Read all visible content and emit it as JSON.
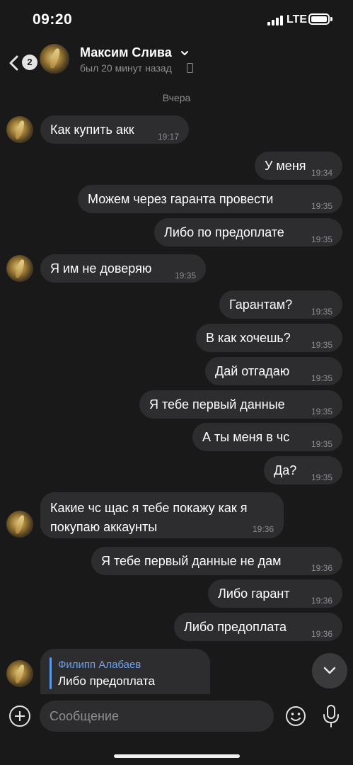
{
  "status_bar": {
    "time": "09:20",
    "network": "LTE"
  },
  "header": {
    "back_badge": "2",
    "contact_name": "Максим Слива",
    "last_seen": "был 20 минут назад"
  },
  "date_separator": "Вчера",
  "messages": [
    {
      "direction": "in",
      "text": "Как купить акк",
      "time": "19:17"
    },
    {
      "direction": "out",
      "text": "У меня",
      "time": "19:34"
    },
    {
      "direction": "out",
      "text": "Можем через гаранта провести",
      "time": "19:35"
    },
    {
      "direction": "out",
      "text": "Либо по предоплате",
      "time": "19:35"
    },
    {
      "direction": "in",
      "text": "Я им не доверяю",
      "time": "19:35"
    },
    {
      "direction": "out",
      "text": "Гарантам?",
      "time": "19:35"
    },
    {
      "direction": "out",
      "text": "В как хочешь?",
      "time": "19:35"
    },
    {
      "direction": "out",
      "text": "Дай отгадаю",
      "time": "19:35"
    },
    {
      "direction": "out",
      "text": "Я тебе первый данные",
      "time": "19:35"
    },
    {
      "direction": "out",
      "text": "А ты меня в чс",
      "time": "19:35"
    },
    {
      "direction": "out",
      "text": "Да?",
      "time": "19:35"
    },
    {
      "direction": "in",
      "text_line1": "Какие чс щас я тебе покажу как я",
      "text_line2": "покупаю аккаунты",
      "time": "19:36"
    },
    {
      "direction": "out",
      "text": "Я тебе первый данные не дам",
      "time": "19:36"
    },
    {
      "direction": "out",
      "text": "Либо гарант",
      "time": "19:36"
    },
    {
      "direction": "out",
      "text": "Либо предоплата",
      "time": "19:36"
    }
  ],
  "reply": {
    "author": "Филипп Алабаев",
    "text": "Либо предоплата"
  },
  "composer": {
    "placeholder": "Сообщение"
  },
  "colors": {
    "background": "#19191a",
    "bubble": "#2d2d30",
    "accent": "#6ea3e8",
    "muted": "#8e8e93"
  }
}
